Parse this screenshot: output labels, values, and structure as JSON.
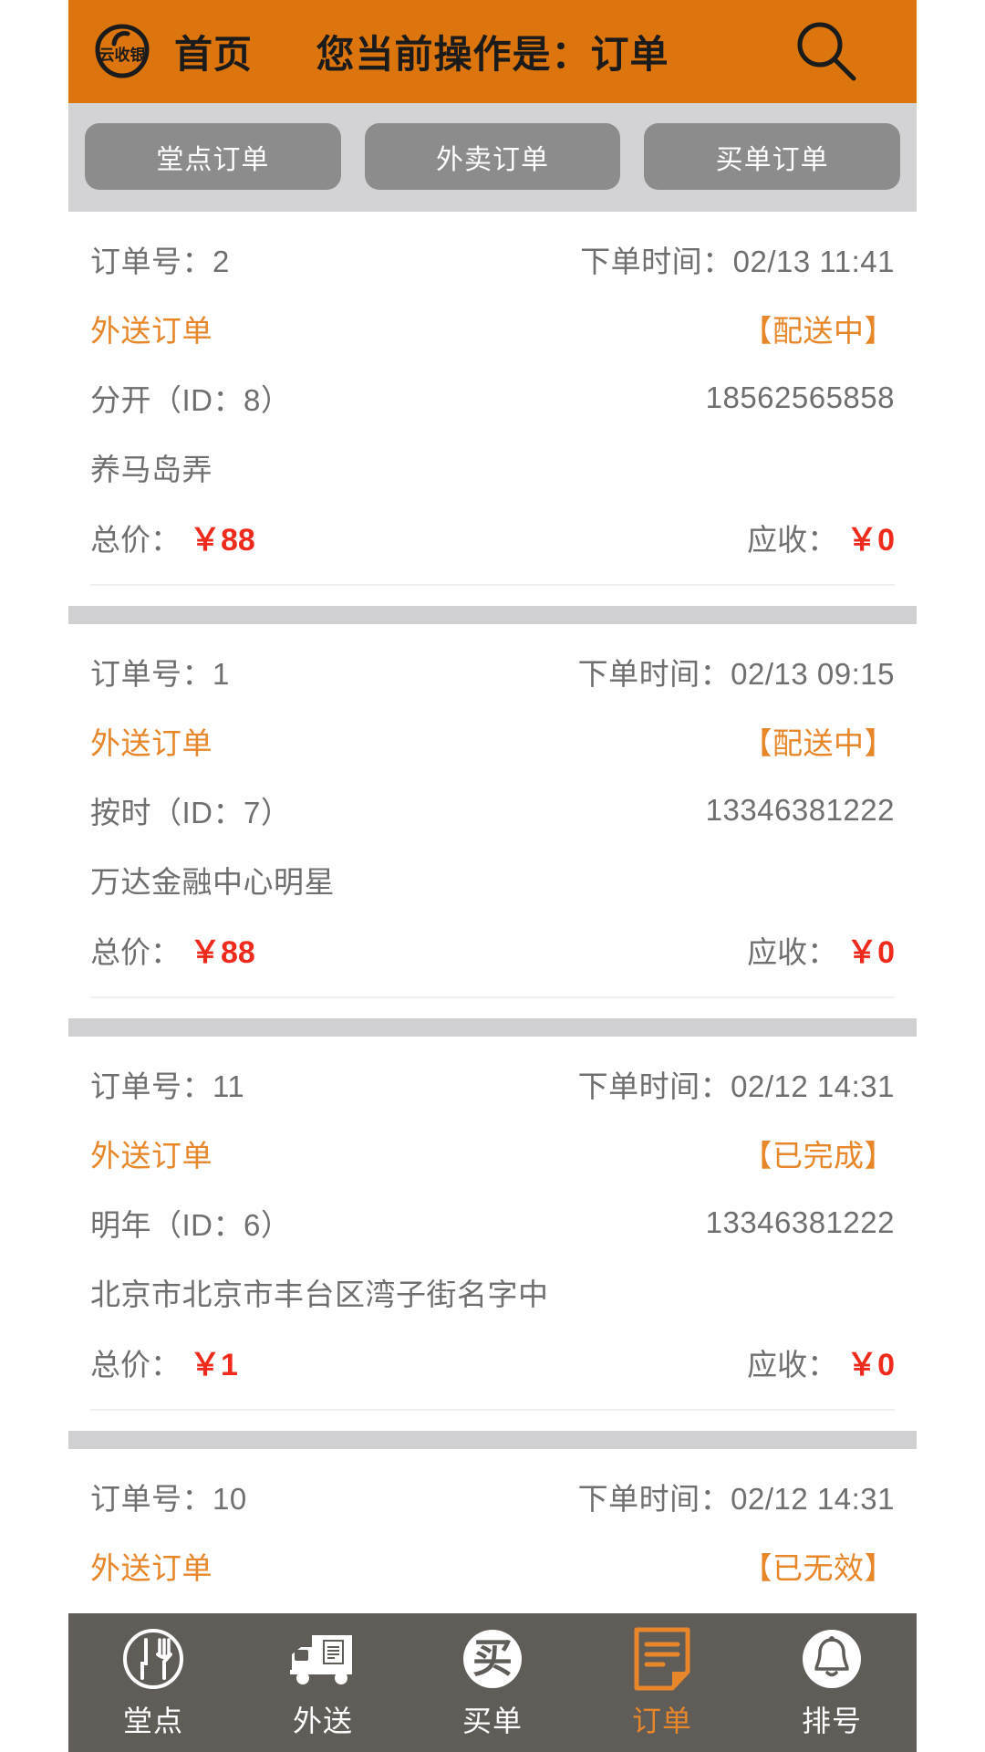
{
  "header": {
    "logo_text": "云收银",
    "logo_icon": "cloud-logo-icon",
    "home_label": "首页",
    "title": "您当前操作是：订单",
    "search_icon": "search-icon"
  },
  "tabs": [
    {
      "label": "堂点订单",
      "name": "tab-dinein-orders"
    },
    {
      "label": "外卖订单",
      "name": "tab-takeout-orders"
    },
    {
      "label": "买单订单",
      "name": "tab-checkout-orders"
    }
  ],
  "labels": {
    "order_no": "订单号：",
    "order_time": "下单时间：",
    "total_price": "总价：",
    "receivable": "应收："
  },
  "orders": [
    {
      "order_no": "订单号：2",
      "order_time": "下单时间：02/13 11:41",
      "type": "外送订单",
      "status": "【配送中】",
      "customer": "分开（ID：8）",
      "phone": "18562565858",
      "address": "养马岛弄",
      "total_label": "总价：",
      "total_value": "￥88",
      "receivable_label": "应收：",
      "receivable_value": "￥0"
    },
    {
      "order_no": "订单号：1",
      "order_time": "下单时间：02/13 09:15",
      "type": "外送订单",
      "status": "【配送中】",
      "customer": "按时（ID：7）",
      "phone": "13346381222",
      "address": "万达金融中心明星",
      "total_label": "总价：",
      "total_value": "￥88",
      "receivable_label": "应收：",
      "receivable_value": "￥0"
    },
    {
      "order_no": "订单号：11",
      "order_time": "下单时间：02/12 14:31",
      "type": "外送订单",
      "status": "【已完成】",
      "customer": "明年（ID：6）",
      "phone": "13346381222",
      "address": "北京市北京市丰台区湾子街名字中",
      "total_label": "总价：",
      "total_value": "￥1",
      "receivable_label": "应收：",
      "receivable_value": "￥0"
    },
    {
      "order_no": "订单号：10",
      "order_time": "下单时间：02/12 14:31",
      "type": "外送订单",
      "status": "【已无效】"
    }
  ],
  "bottom_nav": [
    {
      "label": "堂点",
      "icon": "cutlery-plate-icon",
      "active": false
    },
    {
      "label": "外送",
      "icon": "delivery-truck-icon",
      "active": false
    },
    {
      "label": "买单",
      "icon": "buy-circle-icon",
      "active": false
    },
    {
      "label": "订单",
      "icon": "order-document-icon",
      "active": true
    },
    {
      "label": "排号",
      "icon": "bell-icon",
      "active": false
    }
  ],
  "colors": {
    "brand_orange": "#DC750E",
    "accent_orange": "#E8862A",
    "price_red": "#F02B1D",
    "tabbar_gray": "#D3D3D5",
    "pill_gray": "#8C8C8C",
    "nav_gray": "#605C58",
    "separator_gray": "#D1D1D3",
    "text_gray": "#6F6F6F"
  }
}
